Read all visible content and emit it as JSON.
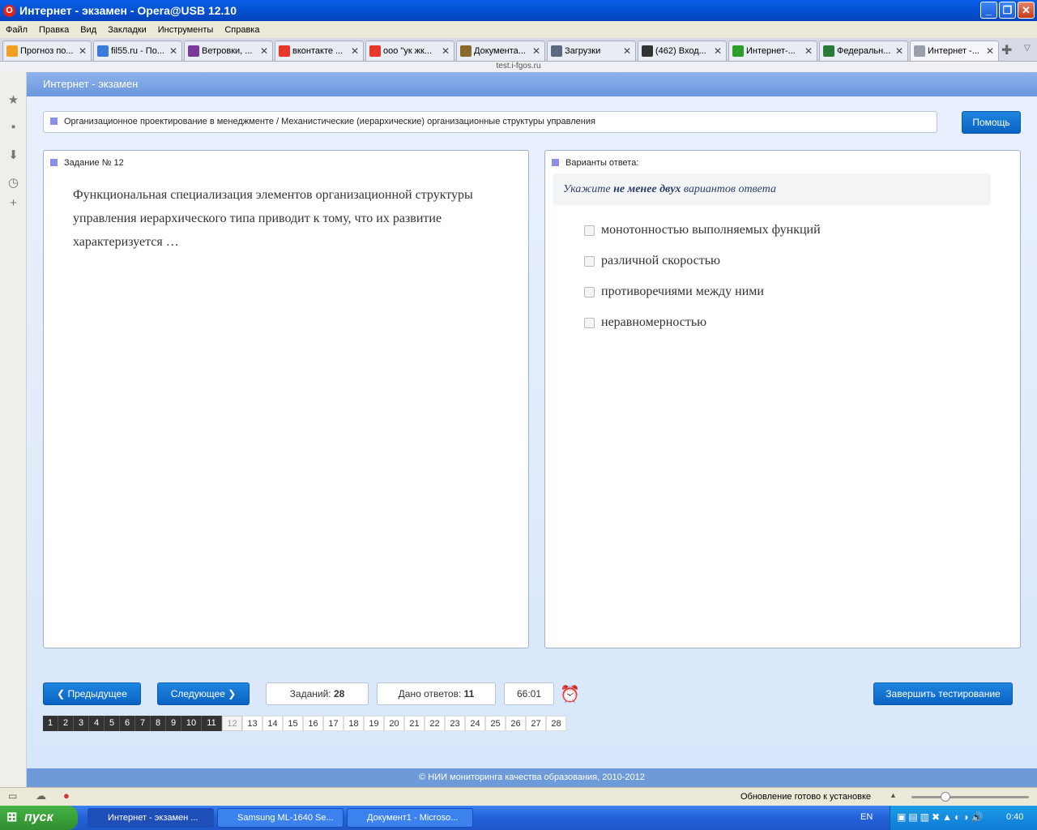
{
  "window": {
    "title": "Интернет - экзамен - Opera@USB 12.10",
    "url": "test.i-fgos.ru"
  },
  "menu": [
    "Файл",
    "Правка",
    "Вид",
    "Закладки",
    "Инструменты",
    "Справка"
  ],
  "tabs": [
    {
      "label": "Прогноз по...",
      "icon_color": "#f0a020"
    },
    {
      "label": "fil55.ru - По...",
      "icon_color": "#3a7ad8"
    },
    {
      "label": "Ветровки, ...",
      "icon_color": "#7a3a9a"
    },
    {
      "label": "вконтакте ...",
      "icon_color": "#e8362a"
    },
    {
      "label": "ооо \"ук жк...",
      "icon_color": "#e8362a"
    },
    {
      "label": "Документа...",
      "icon_color": "#8a6a2a"
    },
    {
      "label": "Загрузки",
      "icon_color": "#5a6a80"
    },
    {
      "label": "(462) Вход...",
      "icon_color": "#333333"
    },
    {
      "label": "Интернет-...",
      "icon_color": "#2aa02a"
    },
    {
      "label": "Федеральн...",
      "icon_color": "#2a7a3a"
    },
    {
      "label": "Интернет -...",
      "icon_color": "#9aa0aa"
    }
  ],
  "page": {
    "header": "Интернет - экзамен",
    "breadcrumb": "Организационное проектирование в менеджменте / Механистические (иерархические) организационные структуры управления",
    "help_label": "Помощь",
    "task_heading": "Задание № 12",
    "question": "Функциональная специализация элементов организационной структуры управления иерархического типа приводит к тому, что их развитие характеризуется …",
    "answers_heading": "Варианты ответа:",
    "hint_pre": "Укажите ",
    "hint_bold": "не менее двух",
    "hint_post": " вариантов ответа",
    "options": [
      "монотонностью выполняемых функций",
      "различной скоростью",
      "противоречиями между ними",
      "неравномерностью"
    ],
    "prev_label": "Предыдущее",
    "next_label": "Следующее",
    "tasks_label": "Заданий:",
    "tasks_count": "28",
    "answered_label": "Дано ответов:",
    "answered_count": "11",
    "timer": "66:01",
    "finish_label": "Завершить тестирование",
    "pages": [
      "1",
      "2",
      "3",
      "4",
      "5",
      "6",
      "7",
      "8",
      "9",
      "10",
      "11",
      "12",
      "13",
      "14",
      "15",
      "16",
      "17",
      "18",
      "19",
      "20",
      "21",
      "22",
      "23",
      "24",
      "25",
      "26",
      "27",
      "28"
    ],
    "answered_pages": 11,
    "current_page": "12",
    "footer": "© НИИ мониторинга качества образования, 2010-2012"
  },
  "statusbar": {
    "update": "Обновление готово к установке"
  },
  "taskbar": {
    "start": "пуск",
    "tasks": [
      "Интернет - экзамен ...",
      "Samsung ML-1640 Se...",
      "Документ1 - Microso..."
    ],
    "lang": "EN",
    "time": "0:40"
  }
}
